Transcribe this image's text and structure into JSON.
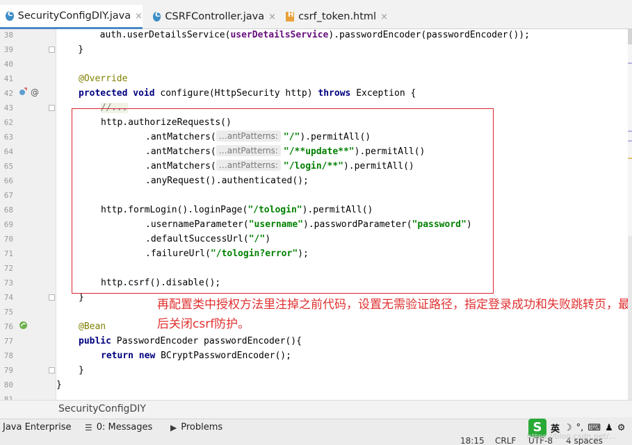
{
  "tabs": [
    {
      "label": "SecurityConfigDIY.java",
      "type": "java",
      "active": true,
      "close": "×"
    },
    {
      "label": "CSRFController.java",
      "type": "java",
      "active": false,
      "close": "×"
    },
    {
      "label": "csrf_token.html",
      "type": "html",
      "active": false,
      "close": "×"
    }
  ],
  "gutter": {
    "line_numbers": [
      "38",
      "39",
      "40",
      "41",
      "42",
      "43",
      "62",
      "63",
      "64",
      "65",
      "66",
      "67",
      "68",
      "69",
      "70",
      "71",
      "72",
      "73",
      "74",
      "75",
      "76",
      "77",
      "78",
      "79",
      "80",
      "81"
    ],
    "icons": {
      "override": "override-icon",
      "at": "@",
      "bean": "bean-icon"
    }
  },
  "code": {
    "l38": {
      "t1": "        auth.userDetailsService(",
      "fld": "userDetailsService",
      "t2": ").passwordEncoder(passwordEncoder());"
    },
    "l39": "    }",
    "l41": "@Override",
    "l42": {
      "kw1": "protected",
      "kw2": "void",
      "t1": " configure(HttpSecurity http) ",
      "kw3": "throws",
      "t2": " Exception {"
    },
    "l43": "//...",
    "l62": "http.authorizeRequests()",
    "l63": {
      "pre": ".antMatchers(",
      "hint": "…antPatterns:",
      "str": "\"/\"",
      "post": ").permitAll()"
    },
    "l64": {
      "pre": ".antMatchers(",
      "hint": "…antPatterns:",
      "str": "\"/**update**\"",
      "post": ").permitAll()"
    },
    "l65": {
      "pre": ".antMatchers(",
      "hint": "…antPatterns:",
      "str": "\"/login/**\"",
      "post": ").permitAll()"
    },
    "l66": ".anyRequest().authenticated();",
    "l68": {
      "pre": "http.formLogin().loginPage(",
      "str": "\"/tologin\"",
      "post": ").permitAll()"
    },
    "l69": {
      "pre": ".usernameParameter(",
      "s1": "\"username\"",
      "mid": ").passwordParameter(",
      "s2": "\"password\"",
      "post": ")"
    },
    "l70": {
      "pre": ".defaultSuccessUrl(",
      "str": "\"/\"",
      "post": ")"
    },
    "l71": {
      "pre": ".failureUrl(",
      "str": "\"/tologin?error\"",
      "post": ");"
    },
    "l73": "http.csrf().disable();",
    "l74": "}",
    "l76": "@Bean",
    "l77": {
      "kw": "public",
      "t": " PasswordEncoder passwordEncoder(){"
    },
    "l78": {
      "kw1": "return",
      "kw2": "new",
      "t": " BCryptPasswordEncoder();"
    },
    "l79": "}",
    "l80": "}"
  },
  "annotation": {
    "text": "再配置类中授权方法里注掉之前代码，设置无需验证路径，指定登录成功和失败跳转页，最后关闭csrf防护。",
    "color": "#e03030"
  },
  "breadcrumb": "SecurityConfigDIY",
  "tool_windows": [
    {
      "label": "Java Enterprise"
    },
    {
      "label": "0: Messages",
      "icon": "messages-icon"
    },
    {
      "label": "Problems",
      "icon": "problems-icon"
    }
  ],
  "ime": {
    "logo": "S",
    "mode": "英",
    "glyphs": [
      "☽",
      "°,",
      "⌨",
      "♟",
      "⚙"
    ]
  },
  "status": {
    "position": "18:15",
    "line_sep": "CRLF",
    "encoding": "UTF-8",
    "indent": "4 spaces"
  },
  "watermark": "https://blog.csdn.net/..."
}
